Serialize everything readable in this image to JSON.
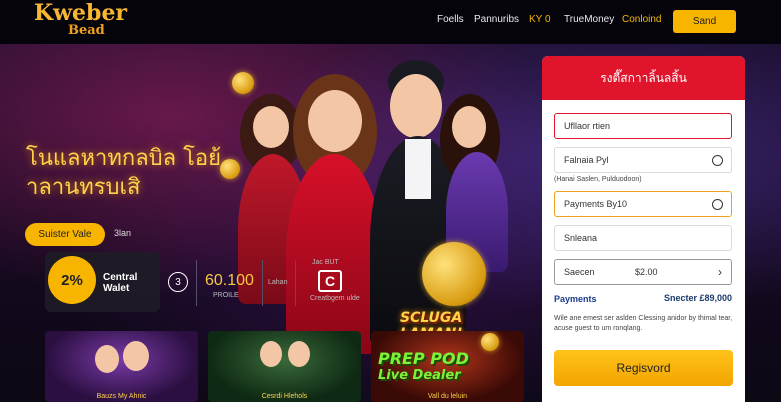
{
  "header": {
    "logo_line1": "Kweber",
    "logo_line2": "Bead",
    "nav": [
      "Foells",
      "Pannuribs",
      "KY 0",
      "TrueMoney",
      "Conloind"
    ],
    "send_label": "Sand"
  },
  "hero": {
    "title": "โนแลหาทกลบิล โอย้าลานทรบเสิ",
    "pill_label": "Suister Vale",
    "pill_side": "3lan",
    "stat_pct": "2%",
    "stat_label_1": "Central",
    "stat_label_2": "Walet",
    "stat_num": "3",
    "big_value": "60.100",
    "big_label": "PROILE",
    "small_label": "Lahan",
    "tiny_label": "Jac BUT",
    "c_letter": "C",
    "c_caption": "Creatbgem ulde",
    "jackpot_text": "SCLUGA LAMAN!"
  },
  "cards": [
    {
      "caption": "Bauzs My Ahnic"
    },
    {
      "caption": "Cesrdi Hlehols"
    },
    {
      "caption": "Vall du leluin",
      "headline_1": "PREP POD",
      "headline_2": "Live Dealer"
    }
  ],
  "panel": {
    "title": "รงตี๊สกาาลิ้นลสิ้น",
    "field_1": "Ufllaor rtien",
    "field_2": "Falnaia Pyl",
    "sub_note": "(Hanai Saslen, Pulduodoon)",
    "field_3": "Payments By10",
    "field_4": "Snleana",
    "field_5_label": "Saecen",
    "field_5_value": "$2.00",
    "payments_label": "Payments",
    "payments_value": "Snecter £89,000",
    "fine_print": "Wile ane emest ser aslden Clessing anidor by thimal tear, acuse guest to um ronqlang.",
    "register_label": "Regisvord"
  }
}
